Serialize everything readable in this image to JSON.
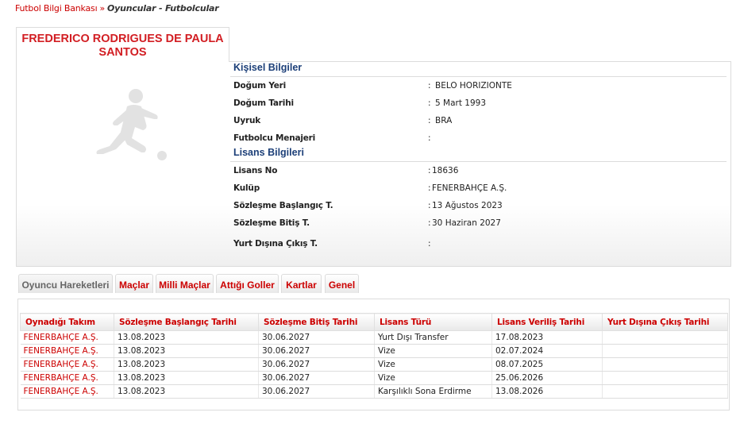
{
  "breadcrumb": {
    "home": "Futbol Bilgi Bankası",
    "separator": "»",
    "current": "Oyuncular - Futbolcular"
  },
  "player": {
    "name": "FREDERICO RODRIGUES DE PAULA SANTOS",
    "photo_icon": "player-silhouette-icon"
  },
  "personal": {
    "title": "Kişisel Bilgiler",
    "rows": [
      {
        "label": "Doğum Yeri",
        "value": "BELO HORIZIONTE"
      },
      {
        "label": "Doğum Tarihi",
        "value": "5 Mart 1993"
      },
      {
        "label": "Uyruk",
        "value": "BRA"
      },
      {
        "label": "Futbolcu Menajeri",
        "value": ""
      }
    ]
  },
  "license": {
    "title": "Lisans Bilgileri",
    "rows": [
      {
        "label": "Lisans No",
        "value": "18636"
      },
      {
        "label": "Kulüp",
        "value": "FENERBAHÇE A.Ş."
      },
      {
        "label": "Sözleşme Başlangıç T.",
        "value": "13 Ağustos 2023"
      },
      {
        "label": "Sözleşme Bitiş T.",
        "value": "30 Haziran 2027"
      },
      {
        "label": "Yurt Dışına Çıkış T.",
        "value": ""
      }
    ]
  },
  "tabs": [
    {
      "label": "Oyuncu Hareketleri",
      "active": true
    },
    {
      "label": "Maçlar",
      "active": false
    },
    {
      "label": "Milli Maçlar",
      "active": false
    },
    {
      "label": "Attığı Goller",
      "active": false
    },
    {
      "label": "Kartlar",
      "active": false
    },
    {
      "label": "Genel",
      "active": false
    }
  ],
  "movements": {
    "columns": [
      "Oynadığı Takım",
      "Sözleşme Başlangıç Tarihi",
      "Sözleşme Bitiş Tarihi",
      "Lisans Türü",
      "Lisans Veriliş Tarihi",
      "Yurt Dışına Çıkış Tarihi"
    ],
    "rows": [
      [
        "FENERBAHÇE A.Ş.",
        "13.08.2023",
        "30.06.2027",
        "Yurt Dışı Transfer",
        "17.08.2023",
        ""
      ],
      [
        "FENERBAHÇE A.Ş.",
        "13.08.2023",
        "30.06.2027",
        "Vize",
        "02.07.2024",
        ""
      ],
      [
        "FENERBAHÇE A.Ş.",
        "13.08.2023",
        "30.06.2027",
        "Vize",
        "08.07.2025",
        ""
      ],
      [
        "FENERBAHÇE A.Ş.",
        "13.08.2023",
        "30.06.2027",
        "Vize",
        "25.06.2026",
        ""
      ],
      [
        "FENERBAHÇE A.Ş.",
        "13.08.2023",
        "30.06.2027",
        "Karşılıklı Sona Erdirme",
        "13.08.2026",
        ""
      ]
    ]
  },
  "colors": {
    "accent_red": "#c00000",
    "name_red": "#d21e23",
    "section_blue": "#1c3f78"
  }
}
